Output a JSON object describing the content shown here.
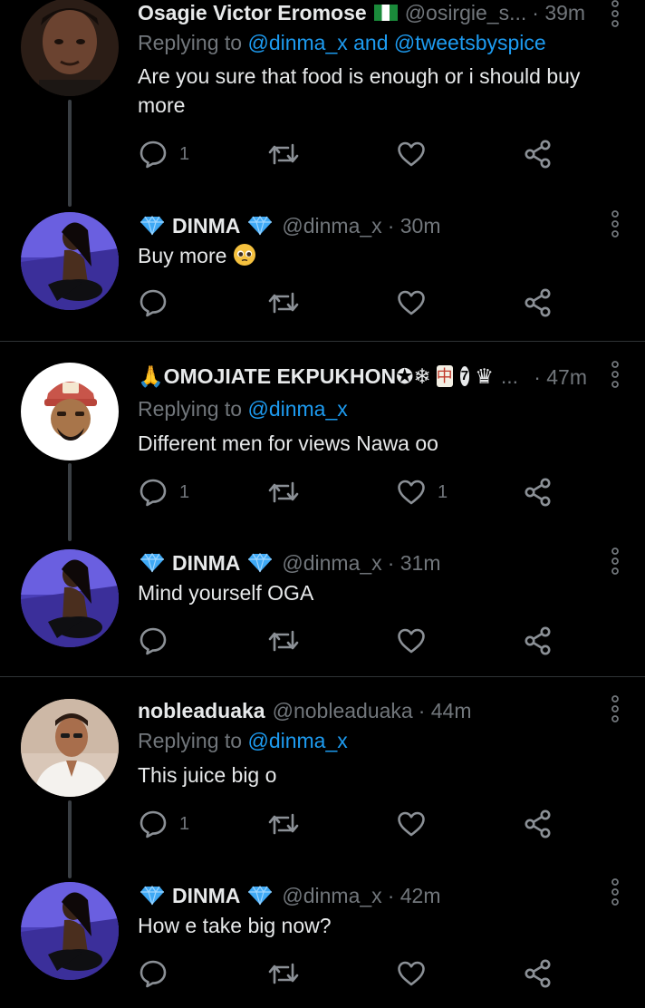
{
  "tweets": [
    {
      "name": "Osagie Victor Eromose",
      "handle": "@osirgie_s...",
      "time": "· 39m",
      "replying_label": "Replying to",
      "replying_to": "@dinma_x and @tweetsbyspice",
      "text": "Are you sure that food is enough or i should buy more",
      "reply_count": "1",
      "like_count": ""
    },
    {
      "name": "DINMA",
      "handle": "@dinma_x",
      "time": "· 30m",
      "text": "Buy more",
      "reply_count": "",
      "like_count": ""
    },
    {
      "name": "🙏OMOJIATE EKPUKHON✪❄",
      "name_suffix": "...",
      "time": "· 47m",
      "replying_label": "Replying to",
      "replying_to": "@dinma_x",
      "text": "Different men for views Nawa oo",
      "reply_count": "1",
      "like_count": "1"
    },
    {
      "name": "DINMA",
      "handle": "@dinma_x",
      "time": "· 31m",
      "text": "Mind yourself OGA",
      "reply_count": "",
      "like_count": ""
    },
    {
      "name": "nobleaduaka",
      "handle": "@nobleaduaka",
      "time": "· 44m",
      "replying_label": "Replying to",
      "replying_to": "@dinma_x",
      "text": "This juice big o",
      "reply_count": "1",
      "like_count": ""
    },
    {
      "name": "DINMA",
      "handle": "@dinma_x",
      "time": "· 42m",
      "text": "How e take big now?",
      "reply_count": "",
      "like_count": ""
    }
  ],
  "colors": {
    "background": "#000000",
    "text": "#e7e9ea",
    "muted": "#71767b",
    "link": "#1d9bf0",
    "divider": "#2f3336",
    "diamond": "#1d9bf0"
  },
  "icons": [
    "reply-icon",
    "retweet-icon",
    "like-icon",
    "share-icon",
    "more-options-icon",
    "diamond-emoji-icon",
    "pleading-face-emoji-icon",
    "nigeria-flag-icon",
    "verified-badge-icon"
  ]
}
